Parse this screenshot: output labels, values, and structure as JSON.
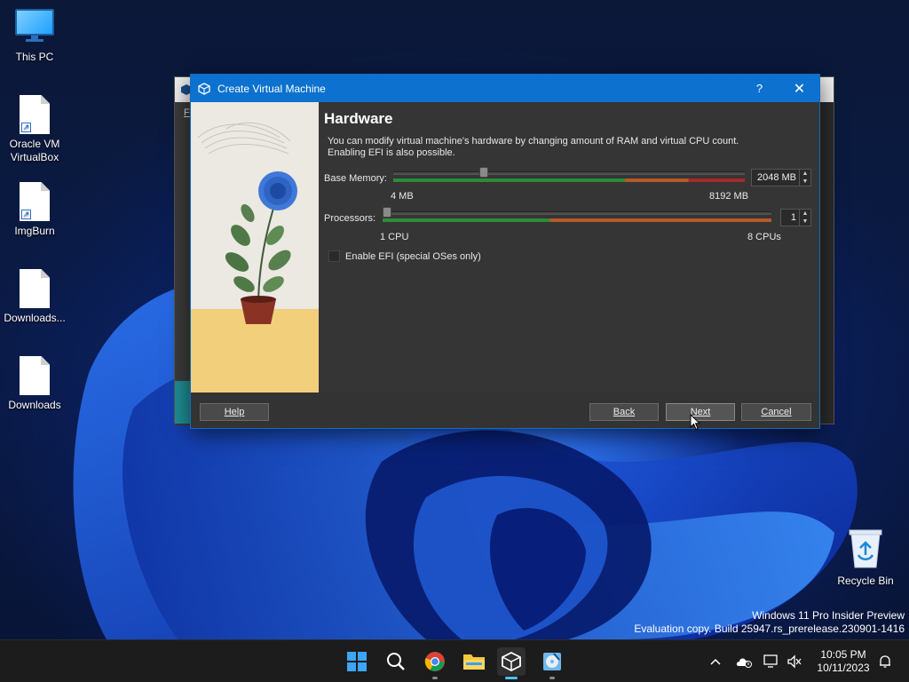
{
  "desktop": {
    "icons": [
      {
        "label": "This PC"
      },
      {
        "label": "Oracle VM VirtualBox"
      },
      {
        "label": "ImgBurn"
      },
      {
        "label": "Downloads..."
      },
      {
        "label": "Downloads"
      }
    ],
    "recycle_bin": {
      "label": "Recycle Bin"
    },
    "watermark": {
      "line1": "Windows 11 Pro Insider Preview",
      "line2": "Evaluation copy. Build 25947.rs_prerelease.230901-1416"
    }
  },
  "background_window": {
    "menu_letter": "F"
  },
  "dialog": {
    "title": "Create Virtual Machine",
    "help_glyph": "?",
    "close_glyph": "✕",
    "page_title": "Hardware",
    "description_line1": "You can modify virtual machine's hardware by changing amount of RAM and virtual CPU count.",
    "description_line2": "Enabling EFI is also possible.",
    "base_memory": {
      "label": "Base Memory:",
      "value": "2048 MB",
      "min_label": "4 MB",
      "max_label": "8192 MB",
      "fraction": 0.25
    },
    "processors": {
      "label": "Processors:",
      "value": "1",
      "min_label": "1 CPU",
      "max_label": "8 CPUs",
      "fraction": 0.0
    },
    "efi_checkbox": {
      "label": "Enable EFI (special OSes only)",
      "checked": false
    },
    "buttons": {
      "help": "Help",
      "back": "Back",
      "next": "Next",
      "cancel": "Cancel"
    }
  },
  "taskbar": {
    "apps": [
      "start-icon",
      "search-icon",
      "chrome-icon",
      "file-explorer-icon",
      "virtualbox-icon",
      "imgburn-icon"
    ],
    "active_app": "virtualbox-icon",
    "clock": {
      "time": "10:05 PM",
      "date": "10/11/2023"
    }
  },
  "colors": {
    "dialog_titlebar": "#0c71cf",
    "dialog_bg": "#353535",
    "slider_green": "#2e8a3a",
    "slider_orange": "#b55a2a",
    "slider_red": "#a62a2a",
    "taskbar_bg": "#1c1c1c",
    "accent": "#4cc2ff"
  }
}
